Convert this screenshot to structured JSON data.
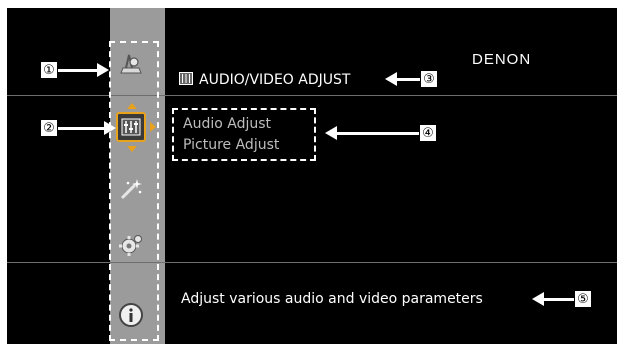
{
  "header": {
    "brand": "DENON",
    "title": "AUDIO/VIDEO ADJUST",
    "title_icon": "av-adjust-icon"
  },
  "menu_icons": [
    {
      "name": "sources-icon",
      "selected": false
    },
    {
      "name": "av-adjust-icon",
      "selected": true
    },
    {
      "name": "wand-icon",
      "selected": false
    },
    {
      "name": "gear-icon",
      "selected": false
    },
    {
      "name": "info-icon",
      "selected": false
    }
  ],
  "submenu": {
    "items": [
      "Audio Adjust",
      "Picture Adjust"
    ]
  },
  "description": "Adjust various audio and video parameters",
  "callouts": [
    "①",
    "②",
    "③",
    "④",
    "⑤"
  ],
  "colors": {
    "screen_bg": "#000000",
    "sidebar_bg": "#9b9b9b",
    "selection_accent": "#e8a21b",
    "submenu_text": "#bdbdbd"
  }
}
